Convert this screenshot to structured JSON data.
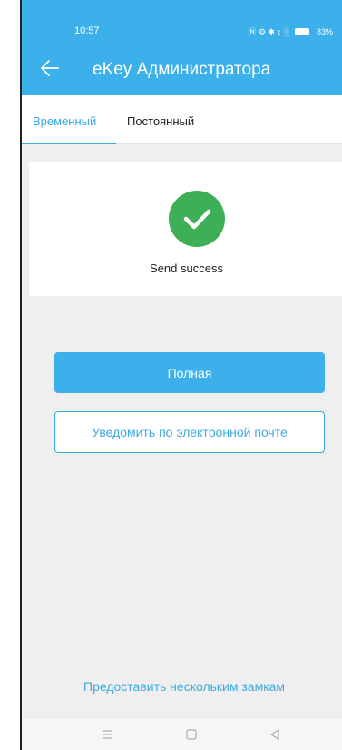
{
  "status": {
    "time": "10:57",
    "icons_text": "Ⓝ ⚙ ✱ ↕ ░",
    "battery": "83%"
  },
  "header": {
    "title": "eKey Администратора",
    "back_icon": "back-arrow-icon"
  },
  "tabs": [
    {
      "label": "Временный",
      "active": true
    },
    {
      "label": "Постоянный",
      "active": false
    }
  ],
  "result": {
    "icon": "check-circle-icon",
    "message": "Send success"
  },
  "actions": {
    "primary_label": "Полная",
    "email_label": "Уведомить по электронной почте",
    "multi_lock_label": "Предоставить нескольким замкам"
  },
  "colors": {
    "accent": "#3bb0ea",
    "success": "#3daf57",
    "background": "#efefef"
  },
  "navbar": {
    "menu_icon": "menu-icon",
    "home_icon": "home-square-icon",
    "back_icon": "back-triangle-icon"
  }
}
